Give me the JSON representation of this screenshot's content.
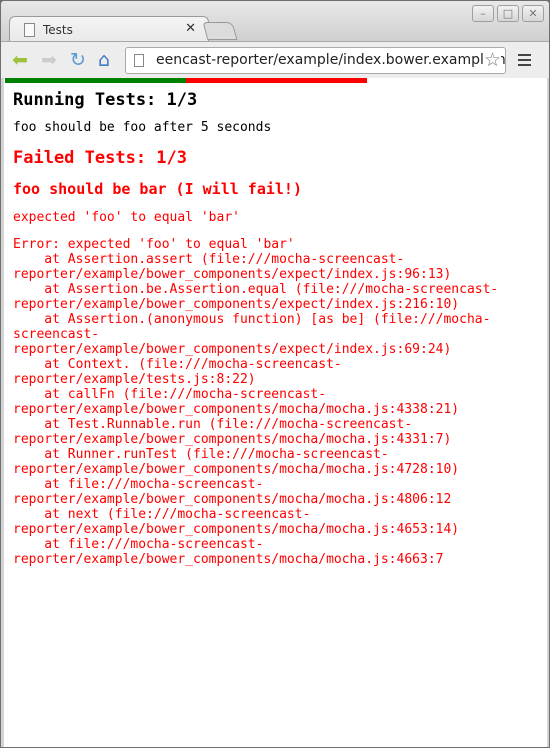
{
  "browser": {
    "tab_title": "Tests",
    "url": "eencast-reporter/example/index.bower.example.html"
  },
  "progress": {
    "passed_fraction": 0.3333,
    "failed_fraction": 0.3333,
    "colors": {
      "passed": "#008000",
      "failed": "#ff0000"
    }
  },
  "running": {
    "title": "Running Tests: 1/3",
    "item": "foo should be foo after 5 seconds"
  },
  "failed": {
    "title": "Failed Tests: 1/3",
    "test_name": "foo should be bar (I will fail!)",
    "message": "expected 'foo' to equal 'bar'",
    "stack": [
      "Error: expected 'foo' to equal 'bar'",
      "    at Assertion.assert (file:///mocha-screencast-",
      "reporter/example/bower_components/expect/index.js:96:13)",
      "    at Assertion.be.Assertion.equal (file:///mocha-screencast-",
      "reporter/example/bower_components/expect/index.js:216:10)",
      "    at Assertion.(anonymous function) [as be] (file:///mocha-",
      "screencast-",
      "reporter/example/bower_components/expect/index.js:69:24)",
      "    at Context. (file:///mocha-screencast-",
      "reporter/example/tests.js:8:22)",
      "    at callFn (file:///mocha-screencast-",
      "reporter/example/bower_components/mocha/mocha.js:4338:21)",
      "    at Test.Runnable.run (file:///mocha-screencast-",
      "reporter/example/bower_components/mocha/mocha.js:4331:7)",
      "    at Runner.runTest (file:///mocha-screencast-",
      "reporter/example/bower_components/mocha/mocha.js:4728:10)",
      "    at file:///mocha-screencast-",
      "reporter/example/bower_components/mocha/mocha.js:4806:12",
      "    at next (file:///mocha-screencast-",
      "reporter/example/bower_components/mocha/mocha.js:4653:14)",
      "    at file:///mocha-screencast-",
      "reporter/example/bower_components/mocha/mocha.js:4663:7"
    ]
  }
}
